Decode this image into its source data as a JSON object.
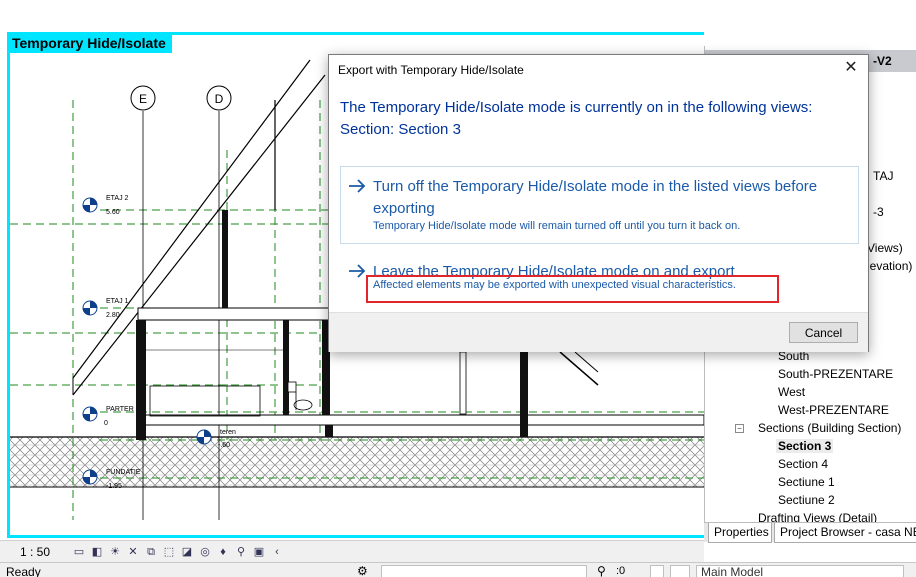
{
  "view": {
    "tab_label": "Temporary Hide/Isolate",
    "grid_bubbles": [
      "E",
      "D"
    ],
    "levels": [
      {
        "name": "ETAJ 2",
        "elevation": "5.60"
      },
      {
        "name": "ETAJ 1",
        "elevation": "2.80"
      },
      {
        "name": "PARTER",
        "elevation": "0"
      },
      {
        "name": "teren",
        "elevation": "-.60"
      },
      {
        "name": "FUNDATIE",
        "elevation": "-1.95"
      }
    ]
  },
  "view_controls": {
    "scale": "1 : 50",
    "icons": [
      "detail-level-icon",
      "visual-style-icon",
      "sun-path-icon",
      "shadows-icon",
      "crop-view-icon",
      "show-crop-icon",
      "temporary-hide-icon",
      "reveal-hidden-icon",
      "temporary-view-properties-icon",
      "analytical-model-icon",
      "highlight-displacement-icon",
      "collapse-icon"
    ]
  },
  "status_bar": {
    "text": "Ready",
    "count": ":0",
    "model": "Main Model"
  },
  "browser": {
    "title_fragment": "-V2",
    "fragments": [
      "TAJ",
      "-3",
      "Views)",
      "levation)"
    ],
    "items": [
      "South",
      "South-PREZENTARE",
      "West",
      "West-PREZENTARE"
    ],
    "sections_label": "Sections (Building Section)",
    "section_items": [
      "Section 3",
      "Section 4",
      "Sectiune 1",
      "Sectiune 2"
    ],
    "drafting_label": "Drafting Views (Detail)",
    "tabs": [
      "Properties",
      "Project Browser - casa NEA"
    ]
  },
  "dialog": {
    "title": "Export with Temporary Hide/Isolate",
    "close_glyph": "✕",
    "main_line1": "The Temporary Hide/Isolate mode is currently on in the following views:",
    "main_line2": "Section: Section 3",
    "option1_main": "Turn off the Temporary Hide/Isolate mode in the listed views before exporting",
    "option1_sub": "Temporary Hide/Isolate mode will remain turned off until you turn it back on.",
    "option2_main": "Leave the Temporary Hide/Isolate mode on and export",
    "option2_sub": "Affected elements may be exported with unexpected visual characteristics.",
    "cancel_label": "Cancel"
  },
  "colors": {
    "view_highlight": "#00e5ff",
    "dialog_text": "#003399",
    "link_text": "#1a5aa8",
    "warning_outline": "#e0252b",
    "grid_green": "#1f8a1f"
  }
}
